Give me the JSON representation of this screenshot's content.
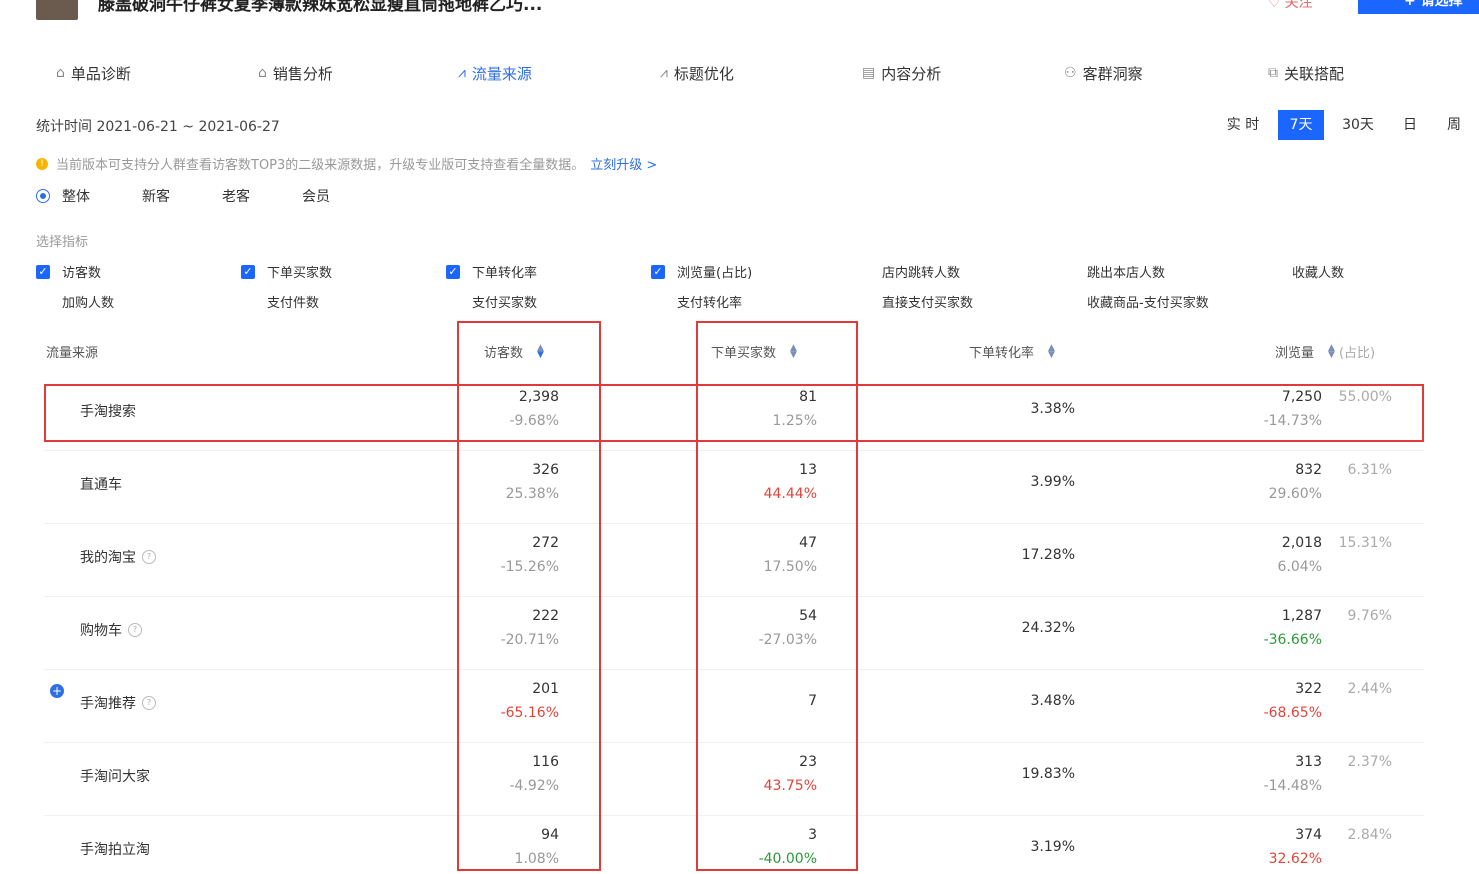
{
  "product": {
    "title": "滕盖破洞牛仔裤女夏季薄款辣妹宽松显瘦直筒拖地裤乙巧...",
    "follow_label": "关注",
    "select_label": "+ 请选择"
  },
  "tabs": [
    {
      "label": "单品诊断",
      "icon": "bag-icon"
    },
    {
      "label": "销售分析",
      "icon": "bag-icon"
    },
    {
      "label": "流量来源",
      "icon": "line-chart-icon",
      "active": true
    },
    {
      "label": "标题优化",
      "icon": "line-chart-icon"
    },
    {
      "label": "内容分析",
      "icon": "document-icon"
    },
    {
      "label": "客群洞察",
      "icon": "users-icon"
    },
    {
      "label": "关联搭配",
      "icon": "link-icon"
    }
  ],
  "stat_time": "统计时间 2021-06-21 ~ 2021-06-27",
  "ranges": [
    {
      "label": "实 时"
    },
    {
      "label": "7天",
      "active": true
    },
    {
      "label": "30天"
    },
    {
      "label": "日"
    },
    {
      "label": "周"
    }
  ],
  "notice": {
    "text": "当前版本可支持分人群查看访客数TOP3的二级来源数据，升级专业版可支持查看全量数据。",
    "link": "立刻升级 >",
    "icon": "info-icon"
  },
  "segments": [
    "整体",
    "新客",
    "老客",
    "会员"
  ],
  "metric_label": "选择指标",
  "metrics": [
    {
      "label": "访客数",
      "checked": true
    },
    {
      "label": "下单买家数",
      "checked": true
    },
    {
      "label": "下单转化率",
      "checked": true
    },
    {
      "label": "浏览量(占比)",
      "checked": true
    },
    {
      "label": "店内跳转人数",
      "checked": false
    },
    {
      "label": "跳出本店人数",
      "checked": false
    },
    {
      "label": "收藏人数",
      "checked": false
    },
    {
      "label": "加购人数",
      "checked": false
    },
    {
      "label": "支付件数",
      "checked": false
    },
    {
      "label": "支付买家数",
      "checked": false
    },
    {
      "label": "支付转化率",
      "checked": false
    },
    {
      "label": "直接支付买家数",
      "checked": false
    },
    {
      "label": "收藏商品-支付买家数",
      "checked": false
    }
  ],
  "table": {
    "headers": {
      "source": "流量来源",
      "visitors": "访客数",
      "buyers": "下单买家数",
      "conversion": "下单转化率",
      "pageviews": "浏览量",
      "share": "(占比)"
    },
    "rows": [
      {
        "source": "手淘搜索",
        "help": false,
        "expand": false,
        "visitors": "2,398",
        "visitors_change": "-9.68%",
        "vc_color": "gray",
        "buyers": "81",
        "buyers_change": "1.25%",
        "bc_color": "gray",
        "conversion": "3.38%",
        "pv": "7,250",
        "pv_share": "55.00%",
        "pv_change": "-14.73%",
        "pc_color": "gray"
      },
      {
        "source": "直通车",
        "help": false,
        "expand": false,
        "visitors": "326",
        "visitors_change": "25.38%",
        "vc_color": "gray",
        "buyers": "13",
        "buyers_change": "44.44%",
        "bc_color": "red",
        "conversion": "3.99%",
        "pv": "832",
        "pv_share": "6.31%",
        "pv_change": "29.60%",
        "pc_color": "gray"
      },
      {
        "source": "我的淘宝",
        "help": true,
        "expand": false,
        "visitors": "272",
        "visitors_change": "-15.26%",
        "vc_color": "gray",
        "buyers": "47",
        "buyers_change": "17.50%",
        "bc_color": "gray",
        "conversion": "17.28%",
        "pv": "2,018",
        "pv_share": "15.31%",
        "pv_change": "6.04%",
        "pc_color": "gray"
      },
      {
        "source": "购物车",
        "help": true,
        "expand": false,
        "visitors": "222",
        "visitors_change": "-20.71%",
        "vc_color": "gray",
        "buyers": "54",
        "buyers_change": "-27.03%",
        "bc_color": "gray",
        "conversion": "24.32%",
        "pv": "1,287",
        "pv_share": "9.76%",
        "pv_change": "-36.66%",
        "pc_color": "green"
      },
      {
        "source": "手淘推荐",
        "help": true,
        "expand": true,
        "visitors": "201",
        "visitors_change": "-65.16%",
        "vc_color": "red",
        "buyers": "7",
        "buyers_change": "",
        "bc_color": "gray",
        "conversion": "3.48%",
        "pv": "322",
        "pv_share": "2.44%",
        "pv_change": "-68.65%",
        "pc_color": "red"
      },
      {
        "source": "手淘问大家",
        "help": false,
        "expand": false,
        "visitors": "116",
        "visitors_change": "-4.92%",
        "vc_color": "gray",
        "buyers": "23",
        "buyers_change": "43.75%",
        "bc_color": "red",
        "conversion": "19.83%",
        "pv": "313",
        "pv_share": "2.37%",
        "pv_change": "-14.48%",
        "pc_color": "gray"
      },
      {
        "source": "手淘拍立淘",
        "help": false,
        "expand": false,
        "visitors": "94",
        "visitors_change": "1.08%",
        "vc_color": "gray",
        "buyers": "3",
        "buyers_change": "-40.00%",
        "bc_color": "green",
        "conversion": "3.19%",
        "pv": "374",
        "pv_share": "2.84%",
        "pv_change": "32.62%",
        "pc_color": "red"
      }
    ]
  }
}
